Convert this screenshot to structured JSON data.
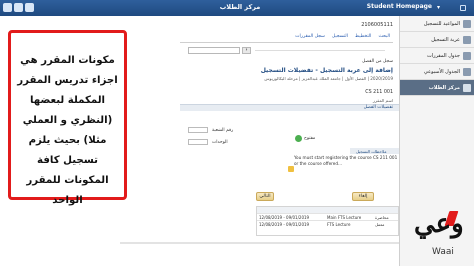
{
  "topbar": {
    "title": "مركز الطلاب",
    "home": "Student Homepage"
  },
  "sidebar": {
    "items": [
      {
        "label": "المواعيد للتسجيل",
        "active": false
      },
      {
        "label": "عربة التسجيل",
        "active": false
      },
      {
        "label": "جدول المقررات",
        "active": false
      },
      {
        "label": "الجدول الأسبوعي",
        "active": false
      },
      {
        "label": "مركز الطلاب",
        "active": true
      }
    ]
  },
  "main": {
    "student_id": "2106005111",
    "search_placeholder": "",
    "tabs": [
      "البحث",
      "التخطيط",
      "التسجيل",
      "سجل المقررات"
    ],
    "heading_small": "سجل من الفصل",
    "heading": "إضافة إلى عربة التسجيل - تفضيلات التسجيل",
    "subline": "2020/2019 | الفصل الأول | جامعة الملك عبدالعزيز | مرحلة البكالوريوس",
    "course_code": "CS 211 001",
    "course_sub": "اسم المقرر",
    "section_title": "تفضيلات الفصل",
    "status_label": "مفتوح",
    "field_label_1": "رقم الشعبة",
    "field_label_2": "الوحدات",
    "notice_title": "ملاحظات التسجيل",
    "notice_text": "You must start registering the course CS 211 001 or the course offered...",
    "buttons": {
      "back": "إلغاء",
      "next": "التالي"
    },
    "table_rows": [
      {
        "date": "12/08/2019 - 09/01/2019",
        "type": "محاضرة",
        "room": "Main FTS Lecture"
      },
      {
        "date": "12/08/2019 - 09/01/2019",
        "type": "معمل",
        "room": "FTS Lecture"
      }
    ]
  },
  "callout": {
    "text": "مكونات المقرر هي اجزاء تدريس المقرر المكملة لبعضها (النظري و العملي مثلا) بحيث يلزم تسجيل كافة المكونات للمقرر الواحد"
  },
  "logo": {
    "arabic": "وعي",
    "latin": "Waai"
  },
  "colors": {
    "topbar": "#2f5f9c",
    "callout_border": "#e21b1b",
    "sidebar_active": "#5a6e86"
  }
}
